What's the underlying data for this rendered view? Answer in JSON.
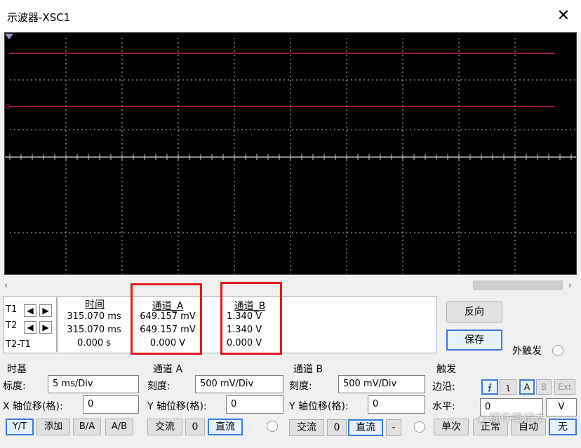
{
  "window": {
    "title": "示波器-XSC1",
    "close_glyph": "✕"
  },
  "scroll": {
    "left": "‹",
    "right": "›"
  },
  "cursors": {
    "t1": "T1",
    "t2": "T2",
    "t2t1": "T2-T1",
    "headers": {
      "time": "时间",
      "cha": "通道_A",
      "chb": "通道_B"
    },
    "rows": [
      {
        "time": "315.070 ms",
        "cha": "649.157 mV",
        "chb": "1.340 V"
      },
      {
        "time": "315.070 ms",
        "cha": "649.157 mV",
        "chb": "1.340 V"
      },
      {
        "time": "0.000 s",
        "cha": "0.000 V",
        "chb": "0.000 V"
      }
    ],
    "arrow_left": "◆←",
    "arrow_right": "→"
  },
  "right_buttons": {
    "reverse": "反向",
    "save": "保存",
    "ext_trigger": "外触发"
  },
  "timebase": {
    "title": "时基",
    "scale_label": "标度:",
    "scale_value": "5 ms/Div",
    "xpos_label": "X 轴位移(格):",
    "xpos_value": "0",
    "modes": [
      "Y/T",
      "添加",
      "B/A",
      "A/B"
    ]
  },
  "channel_a": {
    "title": "通道 A",
    "scale_label": "刻度:",
    "scale_value": "500 mV/Div",
    "ypos_label": "Y 轴位移(格):",
    "ypos_value": "0",
    "coupling": [
      "交流",
      "0",
      "直流"
    ]
  },
  "channel_b": {
    "title": "通道 B",
    "scale_label": "刻度:",
    "scale_value": "500 mV/Div",
    "ypos_label": "Y 轴位移(格):",
    "ypos_value": "0",
    "coupling": [
      "交流",
      "0",
      "直流",
      "-"
    ]
  },
  "trigger": {
    "title": "触发",
    "edge_label": "边沿:",
    "level_label": "水平:",
    "level_value": "0",
    "level_unit": "V",
    "sources": [
      "A",
      "B",
      "Ext"
    ],
    "modes": [
      "单次",
      "正常",
      "自动",
      "无"
    ]
  },
  "watermark": "硬件笔记本",
  "colors": {
    "screen_bg": "#000000",
    "trace_a": "#c0206a",
    "trace_b": "#c01a5a",
    "highlight": "#e31b1b",
    "selected": "#3a7ad6"
  }
}
